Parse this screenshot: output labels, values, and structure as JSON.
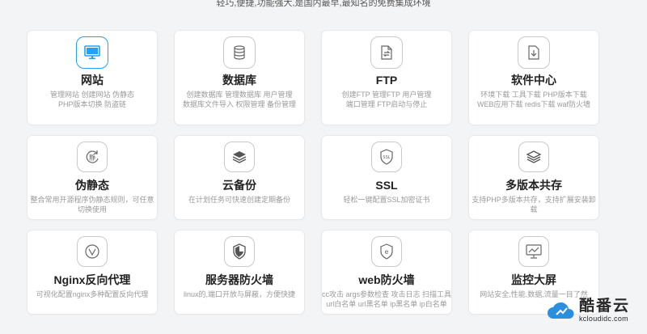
{
  "header": {
    "tagline": "轻巧,便捷,功能强大,是国内最早,最知名的免费集成环境"
  },
  "cards": [
    {
      "title": "网站",
      "desc": [
        "管理网站 创建网站 伪静态",
        "PHP版本切换 防盗链"
      ],
      "icon": "monitor-icon"
    },
    {
      "title": "数据库",
      "desc": [
        "创建数据库 管理数据库 用户管理",
        "数据库文件导入 权限管理 备份管理"
      ],
      "icon": "database-icon"
    },
    {
      "title": "FTP",
      "desc": [
        "创建FTP 管理FTP 用户管理",
        "端口管理 FTP启动与停止"
      ],
      "icon": "ftp-icon"
    },
    {
      "title": "软件中心",
      "desc": [
        "环境下载 工具下载 PHP版本下载",
        "WEB应用下载 redis下载 waf防火墙"
      ],
      "icon": "download-icon"
    },
    {
      "title": "伪静态",
      "desc": [
        "整合常用开源程序伪静态规则，可任意",
        "切换使用"
      ],
      "icon": "static-icon"
    },
    {
      "title": "云备份",
      "desc": [
        "在计划任务可快速创建定期备份"
      ],
      "icon": "layers-icon"
    },
    {
      "title": "SSL",
      "desc": [
        "轻松一键配置SSL加密证书"
      ],
      "icon": "ssl-icon"
    },
    {
      "title": "多版本共存",
      "desc": [
        "支持PHP多版本共存，支持扩展安装卸",
        "载"
      ],
      "icon": "stack-icon"
    },
    {
      "title": "Nginx反向代理",
      "desc": [
        "可视化配置nginx多种配置反向代理"
      ],
      "icon": "nginx-icon"
    },
    {
      "title": "服务器防火墙",
      "desc": [
        "linux的,端口开放与屏蔽，方便快捷"
      ],
      "icon": "shield-icon"
    },
    {
      "title": "web防火墙",
      "desc": [
        "cc攻击 args参数检查 攻击日志 扫描工具",
        "url白名单 url黑名单 ip黑名单 ip白名单"
      ],
      "icon": "web-firewall-icon"
    },
    {
      "title": "监控大屏",
      "desc": [
        "网站安全,性能,数据,流量一目了然"
      ],
      "icon": "chart-icon"
    }
  ],
  "watermark": {
    "main": "酷番云",
    "url": "kcloudidc.com"
  }
}
